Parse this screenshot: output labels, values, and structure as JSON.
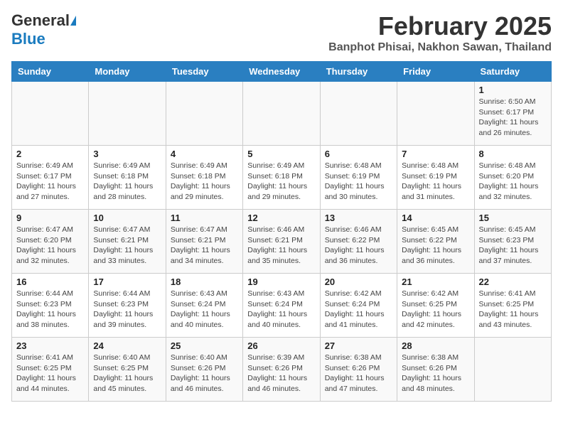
{
  "header": {
    "logo_general": "General",
    "logo_blue": "Blue",
    "month_title": "February 2025",
    "subtitle": "Banphot Phisai, Nakhon Sawan, Thailand"
  },
  "calendar": {
    "days_of_week": [
      "Sunday",
      "Monday",
      "Tuesday",
      "Wednesday",
      "Thursday",
      "Friday",
      "Saturday"
    ],
    "weeks": [
      [
        {
          "day": "",
          "info": ""
        },
        {
          "day": "",
          "info": ""
        },
        {
          "day": "",
          "info": ""
        },
        {
          "day": "",
          "info": ""
        },
        {
          "day": "",
          "info": ""
        },
        {
          "day": "",
          "info": ""
        },
        {
          "day": "1",
          "info": "Sunrise: 6:50 AM\nSunset: 6:17 PM\nDaylight: 11 hours and 26 minutes."
        }
      ],
      [
        {
          "day": "2",
          "info": "Sunrise: 6:49 AM\nSunset: 6:17 PM\nDaylight: 11 hours and 27 minutes."
        },
        {
          "day": "3",
          "info": "Sunrise: 6:49 AM\nSunset: 6:18 PM\nDaylight: 11 hours and 28 minutes."
        },
        {
          "day": "4",
          "info": "Sunrise: 6:49 AM\nSunset: 6:18 PM\nDaylight: 11 hours and 29 minutes."
        },
        {
          "day": "5",
          "info": "Sunrise: 6:49 AM\nSunset: 6:18 PM\nDaylight: 11 hours and 29 minutes."
        },
        {
          "day": "6",
          "info": "Sunrise: 6:48 AM\nSunset: 6:19 PM\nDaylight: 11 hours and 30 minutes."
        },
        {
          "day": "7",
          "info": "Sunrise: 6:48 AM\nSunset: 6:19 PM\nDaylight: 11 hours and 31 minutes."
        },
        {
          "day": "8",
          "info": "Sunrise: 6:48 AM\nSunset: 6:20 PM\nDaylight: 11 hours and 32 minutes."
        }
      ],
      [
        {
          "day": "9",
          "info": "Sunrise: 6:47 AM\nSunset: 6:20 PM\nDaylight: 11 hours and 32 minutes."
        },
        {
          "day": "10",
          "info": "Sunrise: 6:47 AM\nSunset: 6:21 PM\nDaylight: 11 hours and 33 minutes."
        },
        {
          "day": "11",
          "info": "Sunrise: 6:47 AM\nSunset: 6:21 PM\nDaylight: 11 hours and 34 minutes."
        },
        {
          "day": "12",
          "info": "Sunrise: 6:46 AM\nSunset: 6:21 PM\nDaylight: 11 hours and 35 minutes."
        },
        {
          "day": "13",
          "info": "Sunrise: 6:46 AM\nSunset: 6:22 PM\nDaylight: 11 hours and 36 minutes."
        },
        {
          "day": "14",
          "info": "Sunrise: 6:45 AM\nSunset: 6:22 PM\nDaylight: 11 hours and 36 minutes."
        },
        {
          "day": "15",
          "info": "Sunrise: 6:45 AM\nSunset: 6:23 PM\nDaylight: 11 hours and 37 minutes."
        }
      ],
      [
        {
          "day": "16",
          "info": "Sunrise: 6:44 AM\nSunset: 6:23 PM\nDaylight: 11 hours and 38 minutes."
        },
        {
          "day": "17",
          "info": "Sunrise: 6:44 AM\nSunset: 6:23 PM\nDaylight: 11 hours and 39 minutes."
        },
        {
          "day": "18",
          "info": "Sunrise: 6:43 AM\nSunset: 6:24 PM\nDaylight: 11 hours and 40 minutes."
        },
        {
          "day": "19",
          "info": "Sunrise: 6:43 AM\nSunset: 6:24 PM\nDaylight: 11 hours and 40 minutes."
        },
        {
          "day": "20",
          "info": "Sunrise: 6:42 AM\nSunset: 6:24 PM\nDaylight: 11 hours and 41 minutes."
        },
        {
          "day": "21",
          "info": "Sunrise: 6:42 AM\nSunset: 6:25 PM\nDaylight: 11 hours and 42 minutes."
        },
        {
          "day": "22",
          "info": "Sunrise: 6:41 AM\nSunset: 6:25 PM\nDaylight: 11 hours and 43 minutes."
        }
      ],
      [
        {
          "day": "23",
          "info": "Sunrise: 6:41 AM\nSunset: 6:25 PM\nDaylight: 11 hours and 44 minutes."
        },
        {
          "day": "24",
          "info": "Sunrise: 6:40 AM\nSunset: 6:25 PM\nDaylight: 11 hours and 45 minutes."
        },
        {
          "day": "25",
          "info": "Sunrise: 6:40 AM\nSunset: 6:26 PM\nDaylight: 11 hours and 46 minutes."
        },
        {
          "day": "26",
          "info": "Sunrise: 6:39 AM\nSunset: 6:26 PM\nDaylight: 11 hours and 46 minutes."
        },
        {
          "day": "27",
          "info": "Sunrise: 6:38 AM\nSunset: 6:26 PM\nDaylight: 11 hours and 47 minutes."
        },
        {
          "day": "28",
          "info": "Sunrise: 6:38 AM\nSunset: 6:26 PM\nDaylight: 11 hours and 48 minutes."
        },
        {
          "day": "",
          "info": ""
        }
      ]
    ]
  }
}
